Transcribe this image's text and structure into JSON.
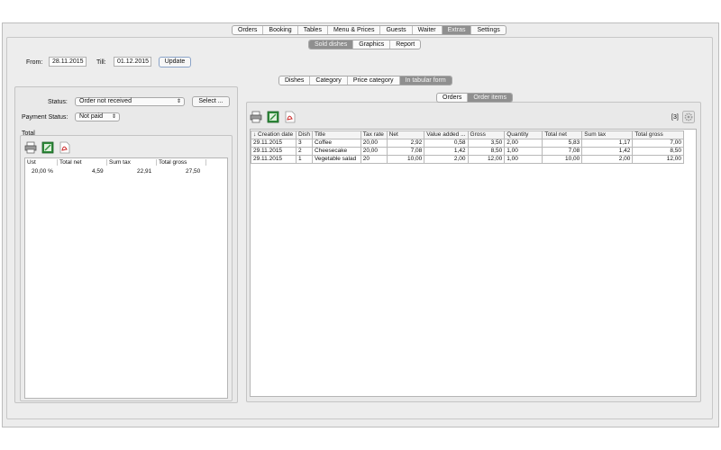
{
  "main_tabs": [
    "Orders",
    "Booking",
    "Tables",
    "Menu & Prices",
    "Guests",
    "Waiter",
    "Extras",
    "Settings"
  ],
  "main_tabs_active": 6,
  "sub_tabs": [
    "Sold dishes",
    "Graphics",
    "Report"
  ],
  "sub_tabs_active": 0,
  "filter": {
    "from_label": "From:",
    "from_value": "28.11.2015",
    "till_label": "Till:",
    "till_value": "01.12.2015",
    "update_label": "Update"
  },
  "view_tabs": [
    "Dishes",
    "Category",
    "Price category",
    "In tabular form"
  ],
  "view_tabs_active": 3,
  "left": {
    "status_label": "Status:",
    "status_value": "Order not received",
    "select_button": "Select ...",
    "payment_label": "Payment Status:",
    "payment_value": "Not paid",
    "total_title": "Total",
    "summary_headers": [
      "Ust",
      "Total net",
      "Sum tax",
      "Total gross"
    ],
    "summary_row": [
      "20,00 %",
      "4,59",
      "22,91",
      "27,50"
    ]
  },
  "right": {
    "tabs": [
      "Orders",
      "Order items"
    ],
    "tabs_active": 1,
    "count": "[3]",
    "columns": [
      "↓ Creation date",
      "Dish",
      "Title",
      "Tax rate",
      "Net",
      "Value added ...",
      "Gross",
      "Quantity",
      "Total net",
      "Sum tax",
      "Total gross"
    ],
    "rows": [
      [
        "29.11.2015",
        "3",
        "Coffee",
        "20,00",
        "2,92",
        "0,58",
        "3,50",
        "2,00",
        "5,83",
        "1,17",
        "7,00"
      ],
      [
        "29.11.2015",
        "2",
        "Cheesecake",
        "20,00",
        "7,08",
        "1,42",
        "8,50",
        "1,00",
        "7,08",
        "1,42",
        "8,50"
      ],
      [
        "29.11.2015",
        "1",
        "Vegetable salad",
        "20",
        "10,00",
        "2,00",
        "12,00",
        "1,00",
        "10,00",
        "2,00",
        "12,00"
      ]
    ]
  },
  "icons": [
    "print-icon",
    "excel-export-icon",
    "pdf-export-icon",
    "gear-icon"
  ],
  "colors": {
    "active_tab": "#8f8f8f",
    "excel_green": "#2e8b3a",
    "pdf_red": "#cc2a2a"
  }
}
